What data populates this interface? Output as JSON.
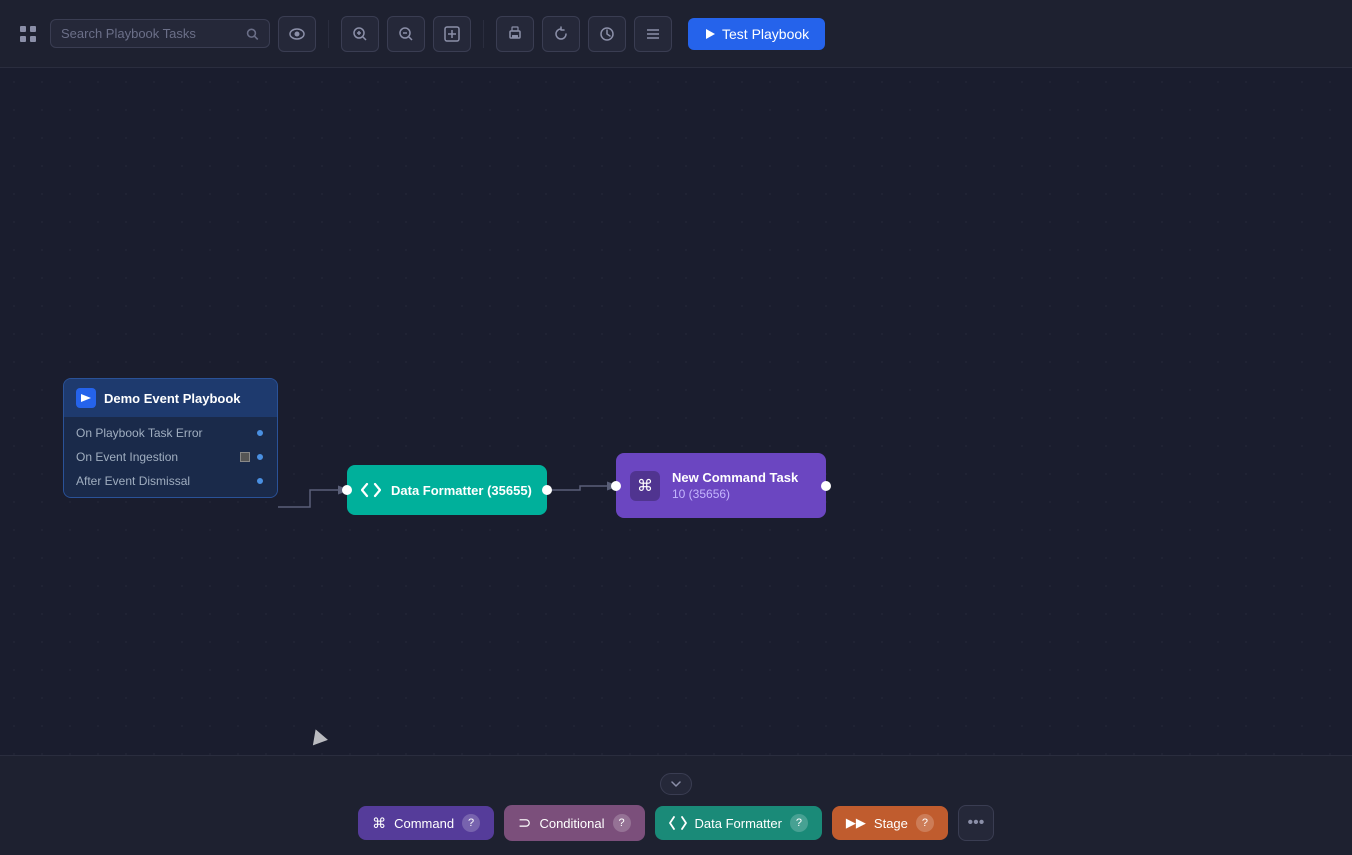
{
  "toolbar": {
    "search_placeholder": "Search Playbook Tasks",
    "test_button_label": "Test Playbook",
    "icons": {
      "grid": "⊞",
      "search": "🔍",
      "eye": "👁",
      "zoom_in": "+",
      "zoom_out": "−",
      "fit": "⊡",
      "print": "🖨",
      "refresh": "↺",
      "clock": "🕐",
      "list": "≡"
    }
  },
  "nodes": {
    "demo_event": {
      "title": "Demo Event Playbook",
      "rows": [
        {
          "label": "On Playbook Task Error",
          "connector": "circle"
        },
        {
          "label": "On Event Ingestion",
          "connector": "square"
        },
        {
          "label": "After Event Dismissal",
          "connector": "circle"
        }
      ]
    },
    "formatter": {
      "label": "Data Formatter (35655)"
    },
    "command": {
      "title": "New Command Task",
      "subtitle": "10 (35656)"
    }
  },
  "bottom_panel": {
    "collapse_icon": "▾",
    "task_types": [
      {
        "key": "command",
        "label": "Command",
        "icon": "⌘",
        "color": "pill-command"
      },
      {
        "key": "conditional",
        "label": "Conditional",
        "icon": "⊃",
        "color": "pill-conditional"
      },
      {
        "key": "formatter",
        "label": "Data Formatter",
        "icon": "</>",
        "color": "pill-formatter"
      },
      {
        "key": "stage",
        "label": "Stage",
        "icon": "▶▶",
        "color": "pill-stage"
      }
    ],
    "more_label": "..."
  }
}
